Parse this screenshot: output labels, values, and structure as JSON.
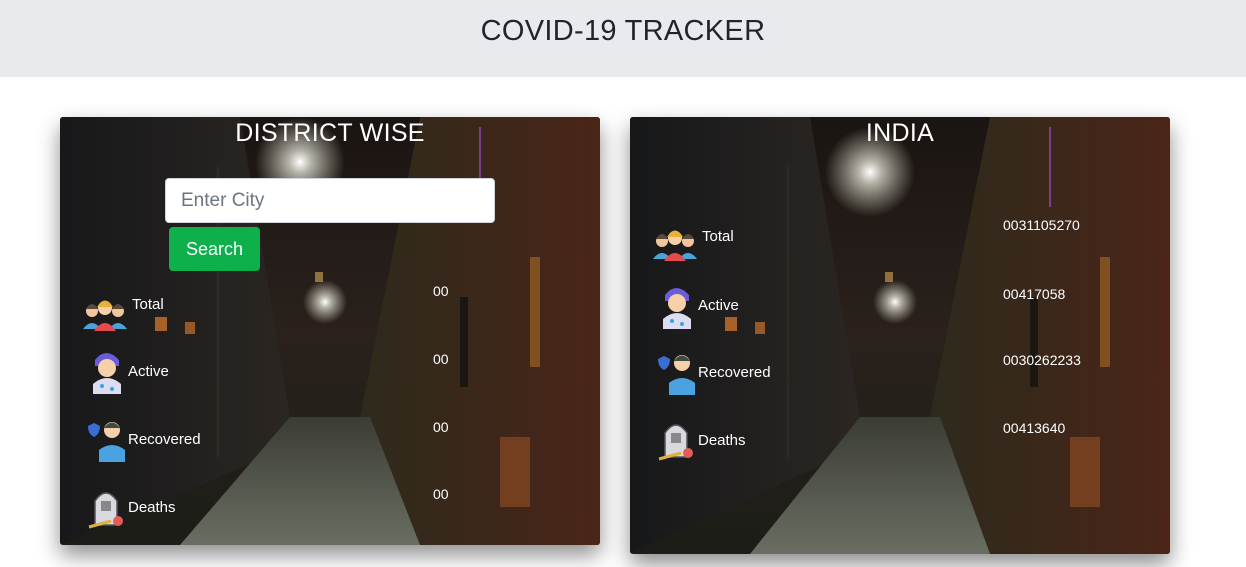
{
  "header": {
    "title": "COVID-19 TRACKER"
  },
  "district": {
    "heading": "DISTRICT WISE",
    "search_placeholder": "Enter City",
    "search_label": "Search",
    "stats": [
      {
        "label": "Total",
        "value": "00",
        "icon": "group-of-people-icon"
      },
      {
        "label": "Active",
        "value": "00",
        "icon": "infected-person-icon"
      },
      {
        "label": "Recovered",
        "value": "00",
        "icon": "recovered-person-shield-icon"
      },
      {
        "label": "Deaths",
        "value": "00",
        "icon": "gravestone-icon"
      }
    ]
  },
  "india": {
    "heading": "INDIA",
    "stats": [
      {
        "label": "Total",
        "value": "0031105270",
        "icon": "group-of-people-icon"
      },
      {
        "label": "Active",
        "value": "00417058",
        "icon": "infected-person-icon"
      },
      {
        "label": "Recovered",
        "value": "0030262233",
        "icon": "recovered-person-shield-icon"
      },
      {
        "label": "Deaths",
        "value": "00413640",
        "icon": "gravestone-icon"
      }
    ]
  },
  "colors": {
    "header_bg": "#e9eaed",
    "search_button": "#0db04b",
    "card_text": "#ffffff"
  }
}
